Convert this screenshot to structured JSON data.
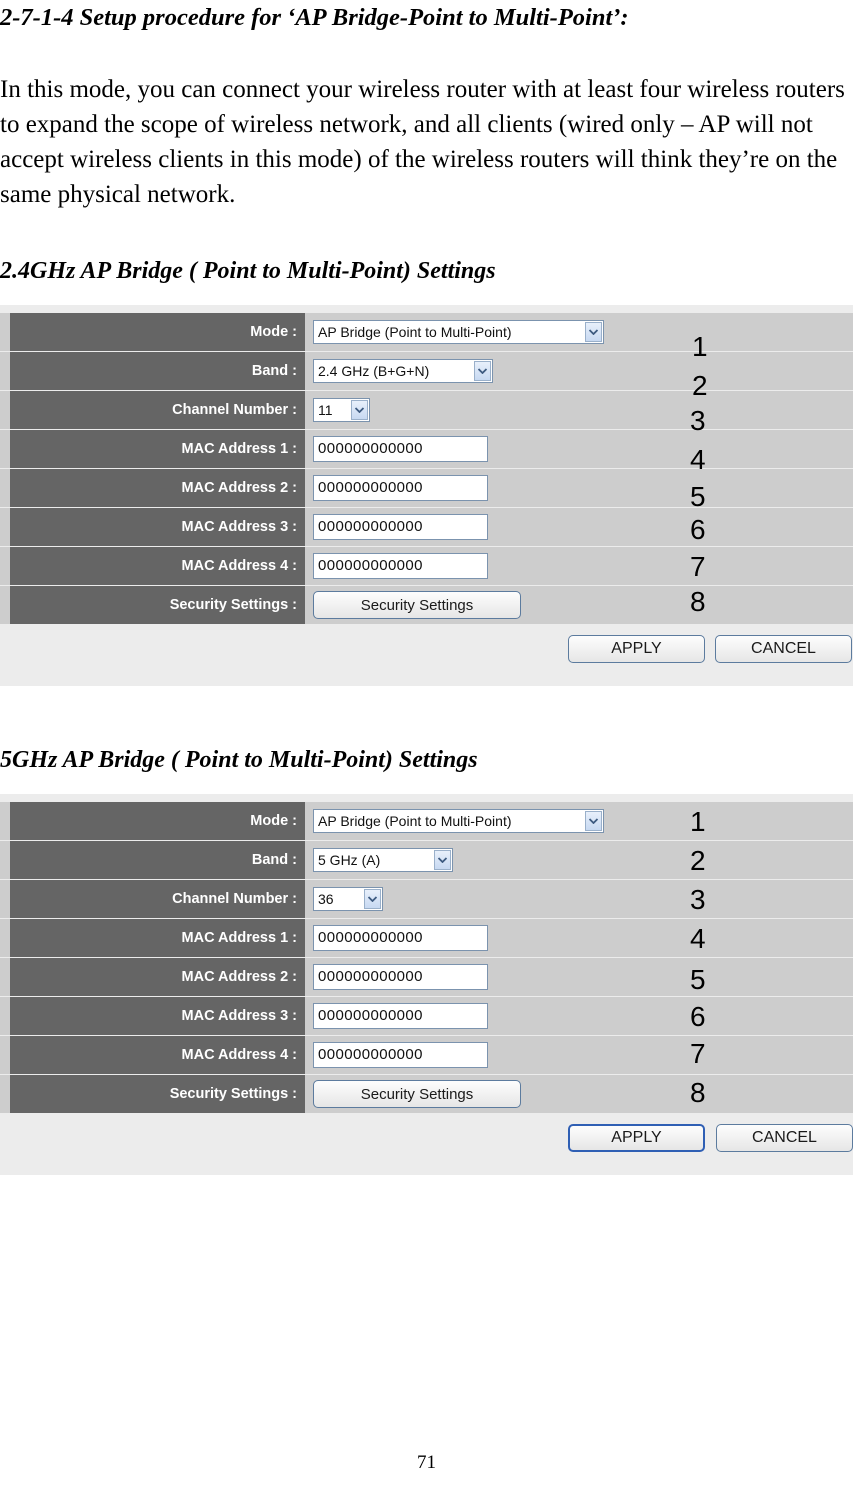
{
  "document": {
    "section_heading": "2-7-1-4 Setup procedure for ‘AP Bridge-Point to Multi-Point’:",
    "paragraph": "In this mode, you can connect your wireless router with at least four wireless routers to expand the scope of wireless network, and all clients (wired only – AP will not accept wireless clients in this mode) of the wireless routers will think they’re on the same physical network.",
    "page_number": "71"
  },
  "panel_24ghz": {
    "title": "2.4GHz AP Bridge ( Point to Multi-Point) Settings",
    "rows": [
      {
        "label": "Mode :",
        "type": "select",
        "value": "AP Bridge (Point to Multi-Point)",
        "annotation": "1"
      },
      {
        "label": "Band :",
        "type": "select",
        "value": "2.4 GHz (B+G+N)",
        "annotation": "2"
      },
      {
        "label": "Channel Number :",
        "type": "select",
        "value": "11",
        "annotation": "3"
      },
      {
        "label": "MAC Address 1 :",
        "type": "input",
        "value": "000000000000",
        "annotation": "4"
      },
      {
        "label": "MAC Address 2 :",
        "type": "input",
        "value": "000000000000",
        "annotation": "5"
      },
      {
        "label": "MAC Address 3 :",
        "type": "input",
        "value": "000000000000",
        "annotation": "6"
      },
      {
        "label": "MAC Address 4 :",
        "type": "input",
        "value": "000000000000",
        "annotation": "7"
      },
      {
        "label": "Security Settings :",
        "type": "button",
        "value": "Security Settings",
        "annotation": "8"
      }
    ],
    "apply_label": "APPLY",
    "cancel_label": "CANCEL"
  },
  "panel_5ghz": {
    "title": "5GHz AP Bridge ( Point to Multi-Point) Settings",
    "rows": [
      {
        "label": "Mode :",
        "type": "select",
        "value": "AP Bridge (Point to Multi-Point)",
        "annotation": "1"
      },
      {
        "label": "Band :",
        "type": "select",
        "value": "5 GHz (A)",
        "annotation": "2"
      },
      {
        "label": "Channel Number :",
        "type": "select",
        "value": "36",
        "annotation": "3"
      },
      {
        "label": "MAC Address 1 :",
        "type": "input",
        "value": "000000000000",
        "annotation": "4"
      },
      {
        "label": "MAC Address 2 :",
        "type": "input",
        "value": "000000000000",
        "annotation": "5"
      },
      {
        "label": "MAC Address 3 :",
        "type": "input",
        "value": "000000000000",
        "annotation": "6"
      },
      {
        "label": "MAC Address 4 :",
        "type": "input",
        "value": "000000000000",
        "annotation": "7"
      },
      {
        "label": "Security Settings :",
        "type": "button",
        "value": "Security Settings",
        "annotation": "8"
      }
    ],
    "apply_label": "APPLY",
    "cancel_label": "CANCEL"
  },
  "colors": {
    "label_cell": "#656565",
    "value_cell": "#cdcdcd",
    "panel_bg": "#ececec",
    "control_border": "#7b93ae",
    "focus_border": "#2f5fb4"
  }
}
